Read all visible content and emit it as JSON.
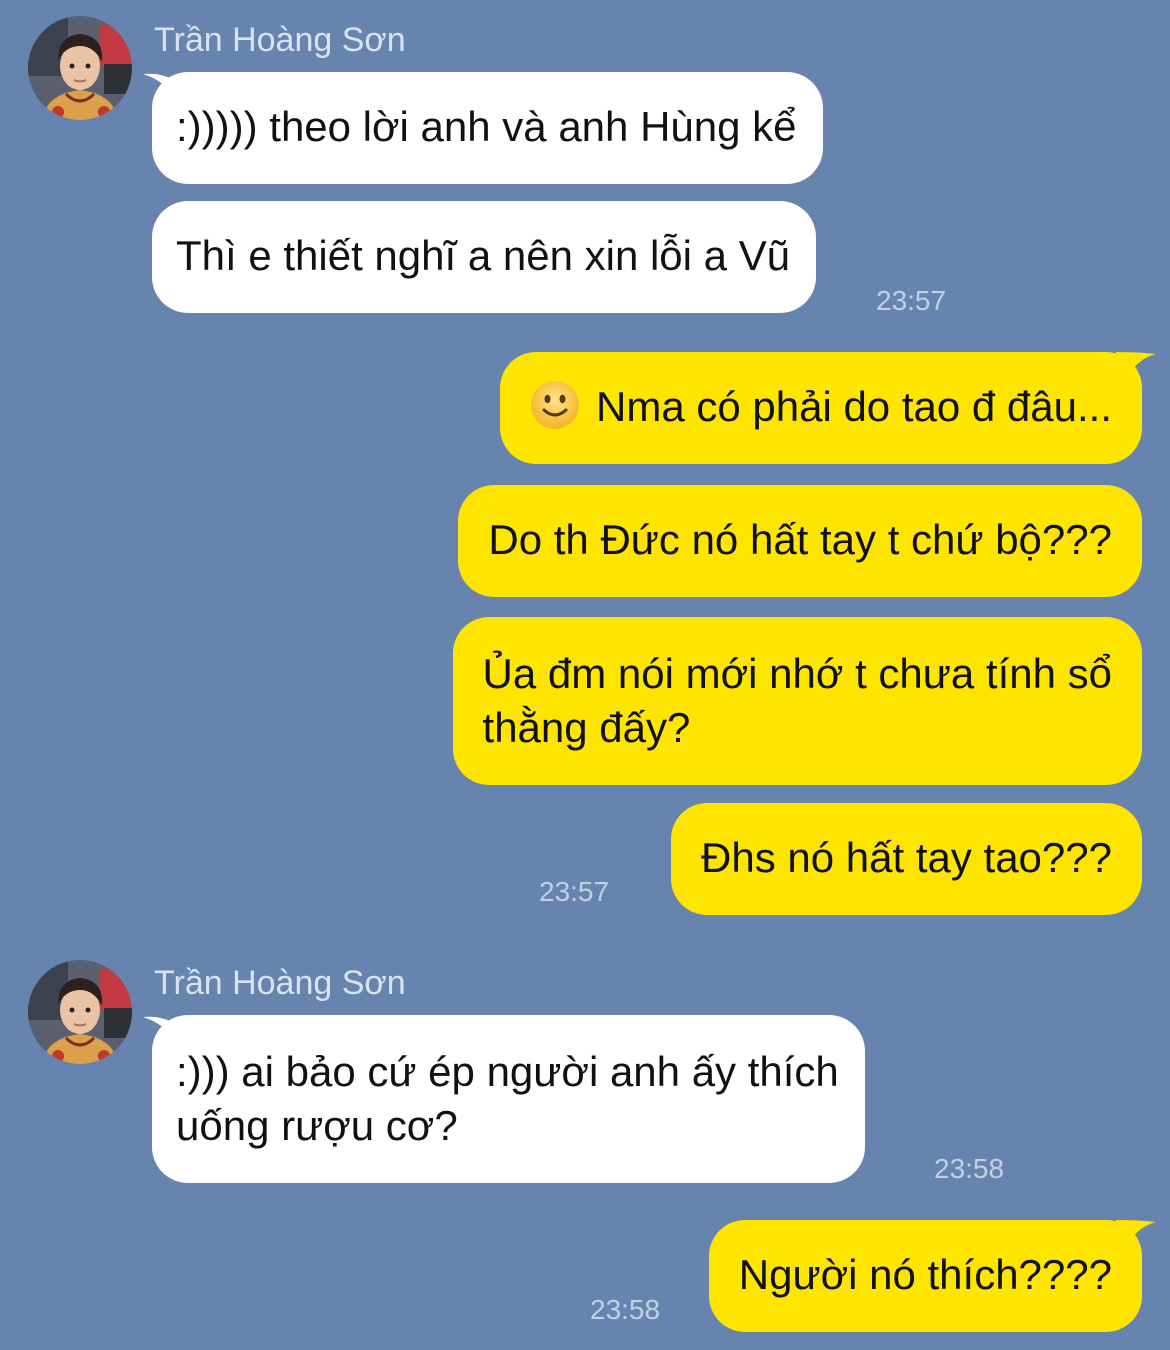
{
  "contact": {
    "name": "Trần Hoàng Sơn"
  },
  "messages": [
    {
      "id": "m1",
      "side": "in",
      "text": ":))))) theo lời anh và anh Hùng kể"
    },
    {
      "id": "m2",
      "side": "in",
      "text": "Thì e thiết nghĩ a nên xin lỗi a Vũ",
      "time": "23:57"
    },
    {
      "id": "m3",
      "side": "out",
      "emoji": "slightly-smiling-face-icon",
      "text": "Nma có phải do tao đ đâu..."
    },
    {
      "id": "m4",
      "side": "out",
      "text": "Do th Đức nó hất tay t chứ bộ???"
    },
    {
      "id": "m5",
      "side": "out",
      "lines": [
        "Ủa đm nói mới nhớ t chưa tính sổ",
        "thằng đấy?"
      ]
    },
    {
      "id": "m6",
      "side": "out",
      "text": "Đhs nó hất tay tao???",
      "time": "23:57"
    },
    {
      "id": "m7",
      "side": "in",
      "lines": [
        ":))) ai bảo cứ ép người anh ấy thích",
        "uống rượu cơ?"
      ],
      "time": "23:58"
    },
    {
      "id": "m8",
      "side": "out",
      "text": "Người nó thích????",
      "time": "23:58"
    }
  ],
  "colors": {
    "background": "#6684ae",
    "incoming_bubble": "#ffffff",
    "outgoing_bubble": "#fee500",
    "timestamp": "#c3d0e2",
    "sender_name": "#d9e2ef"
  }
}
